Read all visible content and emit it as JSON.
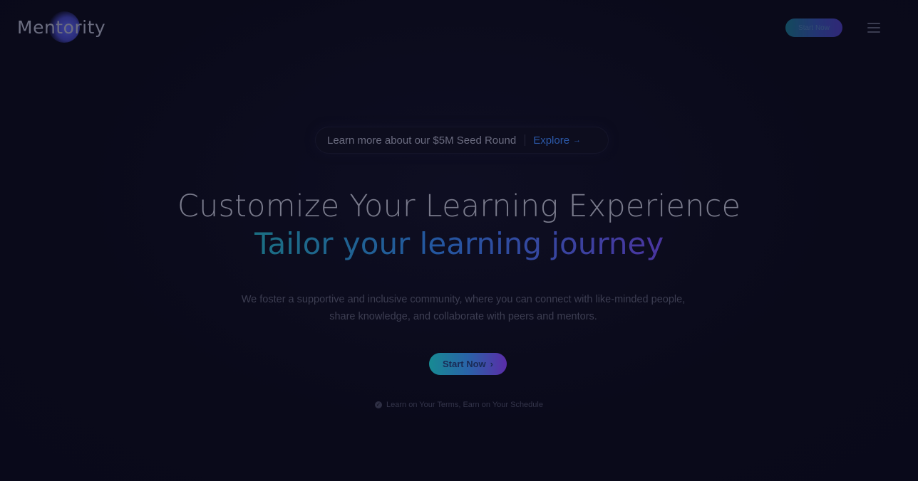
{
  "header": {
    "logo_text": "Mentority",
    "cta_label": "Start Now",
    "menu_icon": "hamburger-menu-icon"
  },
  "announcement": {
    "text": "Learn more about our $5M Seed Round",
    "link_label": "Explore",
    "link_icon": "arrow-right-icon"
  },
  "hero": {
    "headline": "Customize Your Learning Experience",
    "subheadline": "Tailor your learning journey",
    "description": "We foster a supportive and inclusive community, where you can connect with like-minded people, share knowledge, and collaborate with peers and mentors.",
    "cta_label": "Start Now",
    "cta_icon": "chevron-right-icon",
    "tagline": "Learn on Your Terms, Earn on Your Schedule",
    "tagline_icon": "check-circle-icon"
  },
  "colors": {
    "background": "#0a0a1a",
    "gradient_start": "#178a93",
    "gradient_mid": "#2a63a8",
    "gradient_end": "#5a2ca8"
  }
}
